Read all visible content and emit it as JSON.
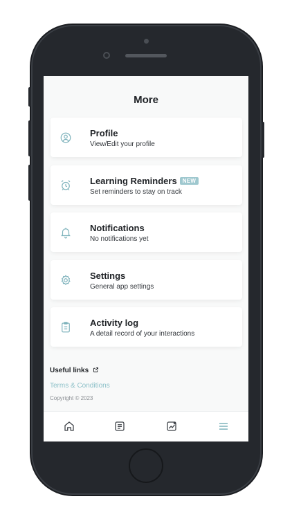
{
  "screen_title": "More",
  "menu": [
    {
      "label": "Profile",
      "description": "View/Edit your profile",
      "icon": "user-circle-icon"
    },
    {
      "label": "Learning Reminders",
      "badge": "NEW",
      "description": "Set reminders to stay on track",
      "icon": "alarm-clock-icon"
    },
    {
      "label": "Notifications",
      "description": "No notifications yet",
      "icon": "bell-icon"
    },
    {
      "label": "Settings",
      "description": "General app settings",
      "icon": "gear-icon"
    },
    {
      "label": "Activity log",
      "description": "A detail record of your interactions",
      "icon": "clipboard-icon"
    }
  ],
  "footer": {
    "useful_links": "Useful links",
    "terms": "Terms & Conditions",
    "copyright": "Copyright © 2023"
  },
  "tabbar": {
    "tabs": [
      "home-icon",
      "document-icon",
      "chart-icon",
      "menu-icon"
    ],
    "active": "menu-icon"
  },
  "colors": {
    "accent": "#8cc0c8",
    "badge": "#9fc8cf",
    "icon_stroke": "#7fb3bc",
    "inactive_icon": "#3c4046"
  }
}
